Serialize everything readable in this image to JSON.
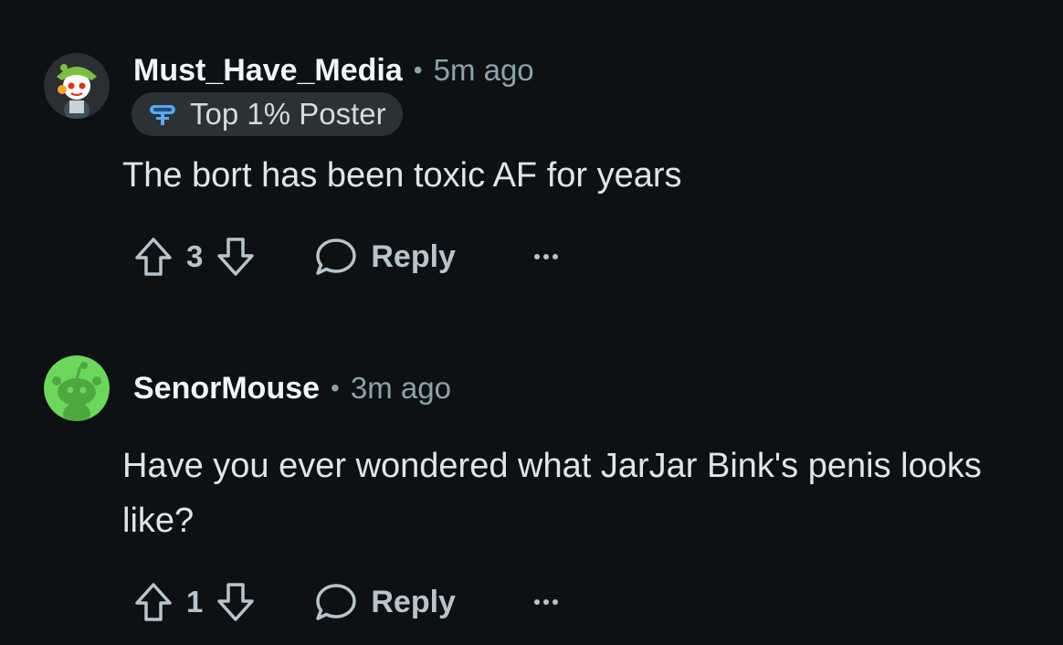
{
  "comments": [
    {
      "username": "Must_Have_Media",
      "separator": "•",
      "time": "5m ago",
      "flair": "Top 1% Poster",
      "text": "The bort has been toxic AF for years",
      "score": "3",
      "reply_label": "Reply",
      "avatar_icon": "snoo-avatar-icon",
      "avatar_bg": "#2b2e33"
    },
    {
      "username": "SenorMouse",
      "separator": "•",
      "time": "3m ago",
      "text": "Have you ever wondered what JarJar Bink's penis looks like?",
      "score": "1",
      "reply_label": "Reply",
      "avatar_icon": "default-snoo-avatar-icon",
      "avatar_bg": "#6cd85b"
    }
  ],
  "colors": {
    "background": "#0e1113",
    "username": "#f2f4f5",
    "meta": "#8ba2ad",
    "body_text": "#dfe5e8",
    "action": "#b7c4cd",
    "flair_bg": "#2a3236"
  }
}
